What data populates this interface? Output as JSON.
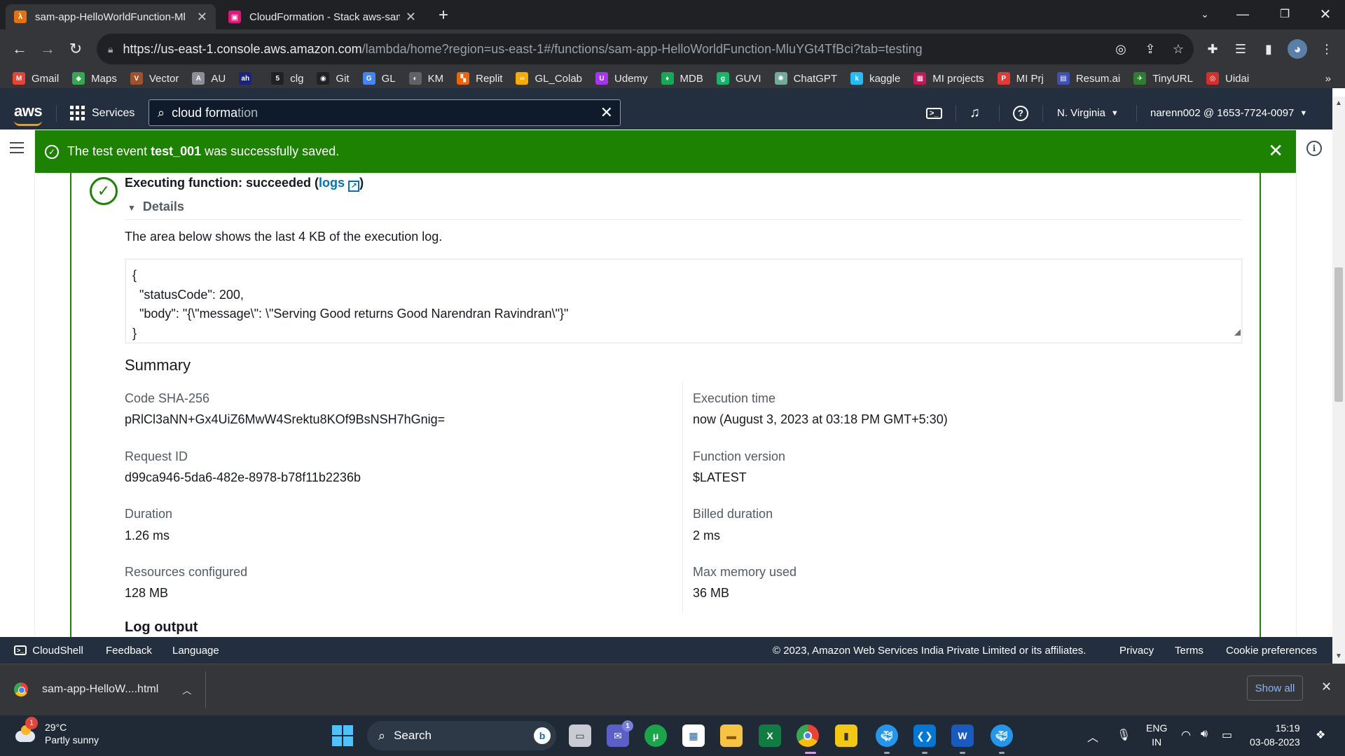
{
  "browser": {
    "tabs": [
      {
        "title": "sam-app-HelloWorldFunction-Ml",
        "active": true,
        "favicon": "lambda-icon",
        "color": "#e8710a"
      },
      {
        "title": "CloudFormation - Stack aws-sam",
        "active": false,
        "favicon": "cloudformation-icon",
        "color": "#e7157b"
      }
    ],
    "new_tab": "+",
    "url_host": "https://us-east-1.console.aws.amazon.com",
    "url_path": "/lambda/home?region=us-east-1#/functions/sam-app-HelloWorldFunction-MluYGt4TfBci?tab=testing",
    "bookmarks": [
      {
        "label": "Gmail",
        "icon": "gmail-icon",
        "color": "#ea4335",
        "glyph": "M"
      },
      {
        "label": "Maps",
        "icon": "maps-icon",
        "color": "#34a853",
        "glyph": "◆"
      },
      {
        "label": "Vector",
        "icon": "vector-icon",
        "color": "#a0522d",
        "glyph": "V"
      },
      {
        "label": "AU",
        "icon": "au-icon",
        "color": "#8a8f98",
        "glyph": "A"
      },
      {
        "label": "",
        "icon": "ah-icon",
        "color": "#1a237e",
        "glyph": "ah"
      },
      {
        "label": "clg",
        "icon": "clg-icon",
        "color": "#202124",
        "glyph": "5"
      },
      {
        "label": "Git",
        "icon": "github-icon",
        "color": "#202124",
        "glyph": "◉"
      },
      {
        "label": "GL",
        "icon": "google-icon",
        "color": "#4285f4",
        "glyph": "G"
      },
      {
        "label": "KM",
        "icon": "km-icon",
        "color": "#5f6368",
        "glyph": "◐"
      },
      {
        "label": "Replit",
        "icon": "replit-icon",
        "color": "#f26207",
        "glyph": "▚"
      },
      {
        "label": "GL_Colab",
        "icon": "colab-icon",
        "color": "#f9ab00",
        "glyph": "∞"
      },
      {
        "label": "Udemy",
        "icon": "udemy-icon",
        "color": "#a435f0",
        "glyph": "U"
      },
      {
        "label": "MDB",
        "icon": "mongodb-icon",
        "color": "#13aa52",
        "glyph": "♦"
      },
      {
        "label": "GUVI",
        "icon": "guvi-icon",
        "color": "#12b76a",
        "glyph": "g"
      },
      {
        "label": "ChatGPT",
        "icon": "chatgpt-icon",
        "color": "#74aa9c",
        "glyph": "✺"
      },
      {
        "label": "kaggle",
        "icon": "kaggle-icon",
        "color": "#20beff",
        "glyph": "k"
      },
      {
        "label": "MI projects",
        "icon": "mi-projects-icon",
        "color": "#c2185b",
        "glyph": "▦"
      },
      {
        "label": "MI Prj",
        "icon": "mi-prj-icon",
        "color": "#e53935",
        "glyph": "P"
      },
      {
        "label": "Resum.ai",
        "icon": "resume-icon",
        "color": "#3f51b5",
        "glyph": "▤"
      },
      {
        "label": "TinyURL",
        "icon": "tinyurl-icon",
        "color": "#2e7d32",
        "glyph": "✈"
      },
      {
        "label": "Uidai",
        "icon": "uidai-icon",
        "color": "#d32f2f",
        "glyph": "◎"
      }
    ],
    "bookmarks_more": "»"
  },
  "aws_nav": {
    "logo": "aws",
    "services_label": "Services",
    "search_value_typed": "cloud forma",
    "search_value_ghost": "tion",
    "region": "N. Virginia",
    "account": "narenn002 @ 1653-7724-0097"
  },
  "flash": {
    "prefix": "The test event ",
    "event_name": "test_001",
    "suffix": " was successfully saved."
  },
  "execution": {
    "title_prefix": "Executing function: succeeded (",
    "logs_link": "logs",
    "title_suffix": ")",
    "details_label": "Details",
    "log_description": "The area below shows the last 4 KB of the execution log.",
    "log_lines": [
      "{",
      "  \"statusCode\": 200,",
      "  \"body\": \"{\\\"message\\\": \\\"Serving Good returns Good Narendran Ravindran\\\"}\"",
      "}"
    ]
  },
  "summary": {
    "heading": "Summary",
    "left": [
      {
        "label": "Code SHA-256",
        "value": "pRlCl3aNN+Gx4UiZ6MwW4Srektu8KOf9BsNSH7hGnig="
      },
      {
        "label": "Request ID",
        "value": "d99ca946-5da6-482e-8978-b78f11b2236b"
      },
      {
        "label": "Duration",
        "value": "1.26 ms"
      },
      {
        "label": "Resources configured",
        "value": "128 MB"
      }
    ],
    "right": [
      {
        "label": "Execution time",
        "value": "now (August 3, 2023 at 03:18 PM GMT+5:30)"
      },
      {
        "label": "Function version",
        "value": "$LATEST"
      },
      {
        "label": "Billed duration",
        "value": "2 ms"
      },
      {
        "label": "Max memory used",
        "value": "36 MB"
      }
    ],
    "log_output_heading": "Log output"
  },
  "aws_footer": {
    "cloudshell": "CloudShell",
    "feedback": "Feedback",
    "language": "Language",
    "copyright": "© 2023, Amazon Web Services India Private Limited or its affiliates.",
    "privacy": "Privacy",
    "terms": "Terms",
    "cookies": "Cookie preferences"
  },
  "downloads": {
    "file": "sam-app-HelloW....html",
    "show_all": "Show all"
  },
  "taskbar": {
    "weather_badge": "1",
    "temperature": "29°C",
    "condition": "Partly sunny",
    "search_label": "Search",
    "teams_badge": "1",
    "lang_line1": "ENG",
    "lang_line2": "IN",
    "time": "15:19",
    "date": "03-08-2023"
  },
  "colors": {
    "aws_nav": "#232f3e",
    "success_green": "#1d8102",
    "link_blue": "#0073bb"
  }
}
